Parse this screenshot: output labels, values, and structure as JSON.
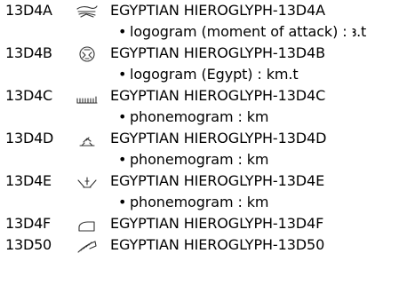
{
  "entries": [
    {
      "code": "13D4A",
      "glyph_icon": "ox-horn-hieroglyph-icon",
      "name": "EGYPTIAN HIEROGLYPH-13D4A",
      "description": "logogram (moment of attack) : ꜣ.t"
    },
    {
      "code": "13D4B",
      "glyph_icon": "circular-land-hieroglyph-icon",
      "name": "EGYPTIAN HIEROGLYPH-13D4B",
      "description": "logogram (Egypt) : km.t"
    },
    {
      "code": "13D4C",
      "glyph_icon": "comb-hieroglyph-icon",
      "name": "EGYPTIAN HIEROGLYPH-13D4C",
      "description": "phonemogram : km"
    },
    {
      "code": "13D4D",
      "glyph_icon": "bird-on-stand-hieroglyph-icon",
      "name": "EGYPTIAN HIEROGLYPH-13D4D",
      "description": "phonemogram : km"
    },
    {
      "code": "13D4E",
      "glyph_icon": "crossed-branches-hieroglyph-icon",
      "name": "EGYPTIAN HIEROGLYPH-13D4E",
      "description": "phonemogram : km"
    },
    {
      "code": "13D4F",
      "glyph_icon": "half-loaf-hieroglyph-icon",
      "name": "EGYPTIAN HIEROGLYPH-13D4F",
      "description": ""
    },
    {
      "code": "13D50",
      "glyph_icon": "feather-hieroglyph-icon",
      "name": "EGYPTIAN HIEROGLYPH-13D50",
      "description": ""
    }
  ],
  "bullet_char": "•",
  "colors": {
    "text": "#000000",
    "glyph_stroke": "#333333",
    "background": "#ffffff"
  }
}
